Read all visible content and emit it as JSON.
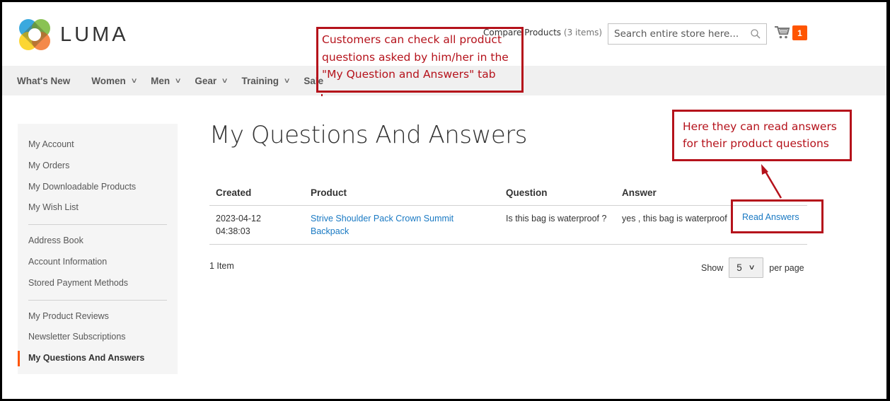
{
  "header": {
    "logo_text": "LUMA",
    "compare_label": "Compare Products",
    "compare_count": "(3 items)",
    "search_placeholder": "Search entire store here...",
    "search_icon": "magnifier-icon",
    "cart_icon": "shopping-cart-icon",
    "cart_count": "1"
  },
  "nav": {
    "items": [
      {
        "label": "What's New",
        "has_dropdown": false
      },
      {
        "label": "Women",
        "has_dropdown": true
      },
      {
        "label": "Men",
        "has_dropdown": true
      },
      {
        "label": "Gear",
        "has_dropdown": true
      },
      {
        "label": "Training",
        "has_dropdown": true
      },
      {
        "label": "Sale",
        "has_dropdown": false
      }
    ]
  },
  "sidebar": {
    "groups": [
      [
        "My Account",
        "My Orders",
        "My Downloadable Products",
        "My Wish List"
      ],
      [
        "Address Book",
        "Account Information",
        "Stored Payment Methods"
      ],
      [
        "My Product Reviews",
        "Newsletter Subscriptions",
        "My Questions And Answers"
      ]
    ],
    "active": "My Questions And Answers"
  },
  "main": {
    "title": "My Questions And Answers",
    "table": {
      "headers": [
        "Created",
        "Product",
        "Question",
        "Answer",
        ""
      ],
      "rows": [
        {
          "created_date": "2023-04-12",
          "created_time": "04:38:03",
          "product": "Strive Shoulder Pack Crown Summit Backpack",
          "question": "Is this bag is waterproof ?",
          "answer": "yes , this bag is waterproof",
          "action": "Read Answers"
        }
      ]
    },
    "items_count": "1 Item",
    "limiter": {
      "show_label": "Show",
      "value": "5",
      "per_page_label": "per page"
    }
  },
  "annotations": {
    "tab_note": "Customers can check all product questions asked by him/her in the \"My Question and Answers\" tab",
    "read_note": "Here they can read answers for their product questions",
    "color": "#b5121b"
  },
  "colors": {
    "accent": "#ff5501",
    "link": "#1979c3",
    "nav_bg": "#f0f0f0",
    "sidebar_bg": "#f5f5f5"
  }
}
